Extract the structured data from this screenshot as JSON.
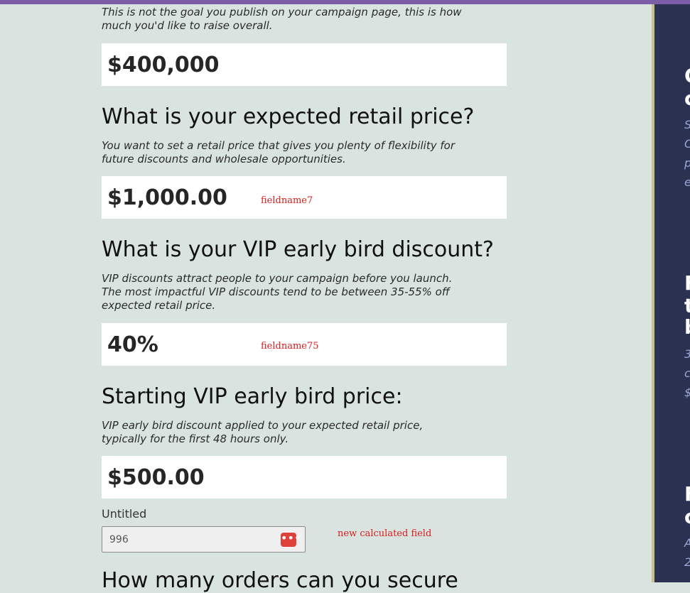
{
  "goal": {
    "desc": "This is not the goal you publish on your campaign page, this is how much you'd like to raise overall.",
    "value": "$400,000"
  },
  "retail": {
    "question": "What is your expected retail price?",
    "desc": "You want to set a retail price that gives you plenty of flexibility for future discounts and wholesale opportunities.",
    "value": "$1,000.00",
    "tag": "fieldname7"
  },
  "discount": {
    "question": "What is your VIP early bird discount?",
    "desc": "VIP discounts attract people to your campaign before you launch. The most impactful VIP discounts tend to be between 35-55% off expected retail price.",
    "value": "40%",
    "tag": "fieldname75"
  },
  "start_price": {
    "question": "Starting VIP early bird price:",
    "desc": "VIP early bird discount applied to your expected retail price, typically for the first 48 hours only.",
    "value": "$500.00"
  },
  "untitled": {
    "label": "Untitled",
    "value": "996",
    "tag": "new calculated field"
  },
  "next_question": "How many orders can you secure",
  "sidebar": {
    "fragments": [
      "C",
      "c",
      "S",
      "C",
      "p",
      "e",
      "F",
      "t",
      "b",
      "3",
      "c",
      "$",
      "F",
      "c",
      "A",
      "2"
    ]
  },
  "colors": {
    "page_bg": "#d9e4e0",
    "accent_bar": "#7b5ea7",
    "sidepanel": "#2b3150",
    "tag_red": "#d91c1c"
  }
}
